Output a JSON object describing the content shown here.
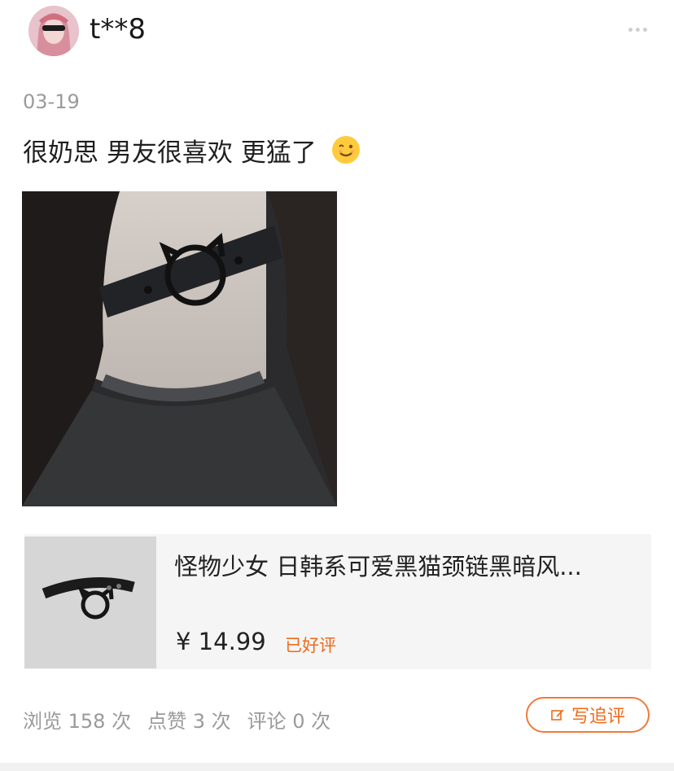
{
  "header": {
    "username": "t**8",
    "more_icon": "more-dots-icon"
  },
  "review": {
    "date": "03-19",
    "text": "很奶思 男友很喜欢 更猛了",
    "emoji": "wink-emoji-icon"
  },
  "product": {
    "title": "怪物少女 日韩系可爱黑猫颈链黑暗风...",
    "price": "¥ 14.99",
    "badge": "已好评"
  },
  "stats": {
    "views": "浏览 158 次",
    "likes": "点赞 3 次",
    "comments": "评论 0 次"
  },
  "actions": {
    "follow_up_review": "写追评",
    "follow_up_icon": "edit-icon"
  },
  "colors": {
    "accent": "#f06a1a",
    "muted_text": "#9a9a9a",
    "card_bg": "#f5f5f5"
  }
}
